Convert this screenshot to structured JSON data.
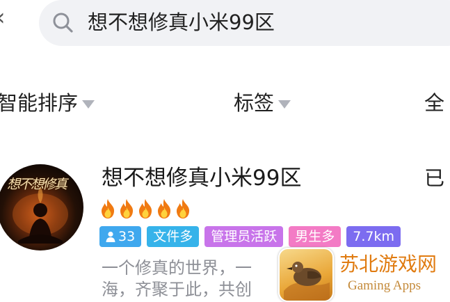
{
  "search": {
    "query": "想不想修真小米99区"
  },
  "filters": [
    {
      "label": "智能排序"
    },
    {
      "label": "标签"
    },
    {
      "label": "全"
    }
  ],
  "group": {
    "avatar_text": "想不想修真",
    "name": "想不想修真小米99区",
    "action_label": "已",
    "heat_level": 5,
    "tags": [
      {
        "label": "33",
        "color": "#3fa8ee",
        "icon": "person-icon"
      },
      {
        "label": "文件多",
        "color": "#36b3ea"
      },
      {
        "label": "管理员活跃",
        "color": "#c874ea"
      },
      {
        "label": "男生多",
        "color": "#f37bc5"
      },
      {
        "label": "7.7km",
        "color": "#7c6cf0"
      }
    ],
    "description_lines": [
      "一个修真的世界，一",
      "海，齐聚于此，共创"
    ]
  },
  "watermark": {
    "title": "苏北游戏网",
    "subtitle": "Gaming Apps"
  }
}
